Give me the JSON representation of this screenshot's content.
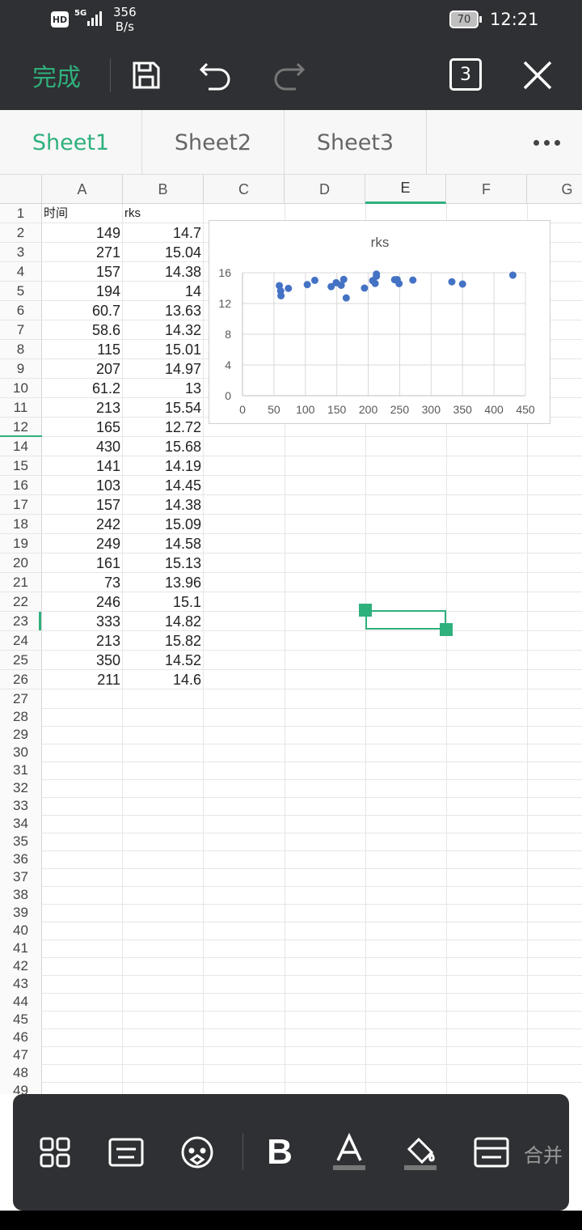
{
  "status": {
    "network": "HD",
    "signal": "5G",
    "speed_value": "356",
    "speed_unit": "B/s",
    "battery": "70",
    "time": "12:21"
  },
  "toolbar": {
    "done_label": "完成",
    "tab_count": "3"
  },
  "sheet_tabs": [
    "Sheet1",
    "Sheet2",
    "Sheet3"
  ],
  "column_headers": [
    "A",
    "B",
    "C",
    "D",
    "E",
    "F",
    "G"
  ],
  "rows": [
    {
      "n": "1",
      "a": "时间",
      "b": "rks"
    },
    {
      "n": "2",
      "a": "149",
      "b": "14.7"
    },
    {
      "n": "3",
      "a": "271",
      "b": "15.04"
    },
    {
      "n": "4",
      "a": "157",
      "b": "14.38"
    },
    {
      "n": "5",
      "a": "194",
      "b": "14"
    },
    {
      "n": "6",
      "a": "60.7",
      "b": "13.63"
    },
    {
      "n": "7",
      "a": "58.6",
      "b": "14.32"
    },
    {
      "n": "8",
      "a": "115",
      "b": "15.01"
    },
    {
      "n": "9",
      "a": "207",
      "b": "14.97"
    },
    {
      "n": "10",
      "a": "61.2",
      "b": "13"
    },
    {
      "n": "11",
      "a": "213",
      "b": "15.54"
    },
    {
      "n": "12",
      "a": "165",
      "b": "12.72"
    },
    {
      "n": "14",
      "a": "430",
      "b": "15.68"
    },
    {
      "n": "15",
      "a": "141",
      "b": "14.19"
    },
    {
      "n": "16",
      "a": "103",
      "b": "14.45"
    },
    {
      "n": "17",
      "a": "157",
      "b": "14.38"
    },
    {
      "n": "18",
      "a": "242",
      "b": "15.09"
    },
    {
      "n": "19",
      "a": "249",
      "b": "14.58"
    },
    {
      "n": "20",
      "a": "161",
      "b": "15.13"
    },
    {
      "n": "21",
      "a": "73",
      "b": "13.96"
    },
    {
      "n": "22",
      "a": "246",
      "b": "15.1"
    },
    {
      "n": "23",
      "a": "333",
      "b": "14.82"
    },
    {
      "n": "24",
      "a": "213",
      "b": "15.82"
    },
    {
      "n": "25",
      "a": "350",
      "b": "14.52"
    },
    {
      "n": "26",
      "a": "211",
      "b": "14.6"
    },
    {
      "n": "27",
      "a": "",
      "b": ""
    },
    {
      "n": "28",
      "a": "",
      "b": ""
    },
    {
      "n": "29",
      "a": "",
      "b": ""
    },
    {
      "n": "30",
      "a": "",
      "b": ""
    },
    {
      "n": "31",
      "a": "",
      "b": ""
    },
    {
      "n": "32",
      "a": "",
      "b": ""
    },
    {
      "n": "33",
      "a": "",
      "b": ""
    },
    {
      "n": "34",
      "a": "",
      "b": ""
    },
    {
      "n": "35",
      "a": "",
      "b": ""
    },
    {
      "n": "36",
      "a": "",
      "b": ""
    },
    {
      "n": "37",
      "a": "",
      "b": ""
    },
    {
      "n": "38",
      "a": "",
      "b": ""
    },
    {
      "n": "39",
      "a": "",
      "b": ""
    },
    {
      "n": "40",
      "a": "",
      "b": ""
    },
    {
      "n": "41",
      "a": "",
      "b": ""
    },
    {
      "n": "42",
      "a": "",
      "b": ""
    },
    {
      "n": "43",
      "a": "",
      "b": ""
    },
    {
      "n": "44",
      "a": "",
      "b": ""
    },
    {
      "n": "45",
      "a": "",
      "b": ""
    },
    {
      "n": "46",
      "a": "",
      "b": ""
    },
    {
      "n": "47",
      "a": "",
      "b": ""
    },
    {
      "n": "48",
      "a": "",
      "b": ""
    },
    {
      "n": "49",
      "a": "",
      "b": ""
    }
  ],
  "bottom_bar": {
    "merge_label": "合并"
  },
  "colors": {
    "accent": "#2fb07c",
    "toolbar_bg": "#2f3033",
    "point": "#4472c4"
  },
  "chart_data": {
    "type": "scatter",
    "title": "rks",
    "xlim": [
      0,
      450
    ],
    "ylim": [
      0,
      16
    ],
    "xticks": [
      0,
      50,
      100,
      150,
      200,
      250,
      300,
      350,
      400,
      450
    ],
    "yticks": [
      0,
      4,
      8,
      12,
      16
    ],
    "grid": true,
    "legend": "none",
    "x": [
      149,
      271,
      157,
      194,
      60.7,
      58.6,
      115,
      207,
      61.2,
      213,
      165,
      430,
      141,
      103,
      157,
      242,
      249,
      161,
      73,
      246,
      333,
      213,
      350,
      211
    ],
    "y": [
      14.7,
      15.04,
      14.38,
      14,
      13.63,
      14.32,
      15.01,
      14.97,
      13,
      15.54,
      12.72,
      15.68,
      14.19,
      14.45,
      14.38,
      15.09,
      14.58,
      15.13,
      13.96,
      15.1,
      14.82,
      15.82,
      14.52,
      14.6
    ]
  }
}
